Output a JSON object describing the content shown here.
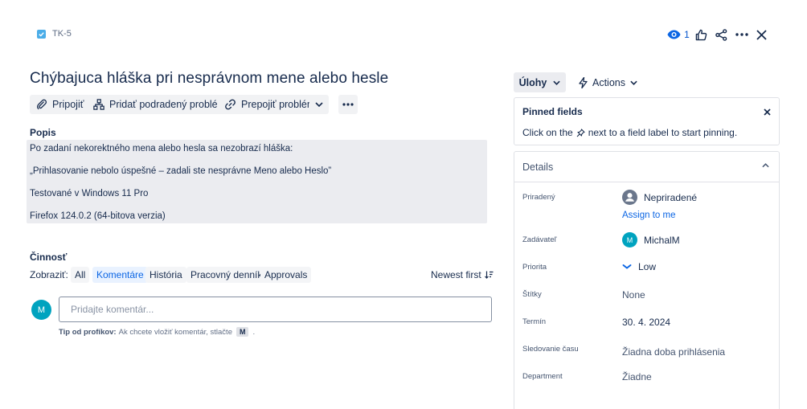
{
  "issue": {
    "key": "TK-5",
    "title": "Chýbajuca hláška pri nesprávnom mene alebo hesle"
  },
  "header": {
    "watchers": "1",
    "watch_icon": "eye-icon",
    "like_icon": "thumbs-up-icon",
    "share_icon": "share-icon",
    "more_icon": "more-icon",
    "close_icon": "close-icon"
  },
  "toolbar": {
    "attach": "Pripojiť",
    "add_child": "Pridať podradený problém",
    "link": "Prepojiť problém"
  },
  "description": {
    "label": "Popis",
    "lines": [
      "Po zadaní nekorektného mena alebo hesla sa nezobrazí hláška:",
      "„Prihlasovanie nebolo úspešné – zadali ste nesprávne Meno alebo Heslo”",
      "Testované v Windows 11 Pro",
      "Firefox 124.0.2 (64-bitova verzia)"
    ]
  },
  "activity": {
    "label": "Činnosť",
    "show_label": "Zobraziť:",
    "filters": [
      "All",
      "Komentáre",
      "História",
      "Pracovný denník",
      "Approvals"
    ],
    "active_filter": "Komentáre",
    "sort": "Newest first",
    "comment_placeholder": "Pridajte komentár...",
    "avatar_initial": "M",
    "tip_bold": "Tip od profíkov:",
    "tip_text": "Ak chcete vložiť komentár, stlačte",
    "tip_key": "M",
    "tip_end": "."
  },
  "sidebar": {
    "status": "Úlohy",
    "actions": "Actions",
    "pinned": {
      "title": "Pinned fields",
      "text_before": "Click on the",
      "text_after": "next to a field label to start pinning."
    },
    "details": {
      "title": "Details",
      "fields": [
        {
          "label": "Priradený",
          "value": "Nepriradené"
        },
        {
          "label": "Zadávateľ",
          "value": "MichalM"
        },
        {
          "label": "Priorita",
          "value": "Low"
        },
        {
          "label": "Štítky",
          "value": "None"
        },
        {
          "label": "Termín",
          "value": "30. 4. 2024"
        },
        {
          "label": "Sledovanie času",
          "value": "Žiadna doba prihlásenia"
        },
        {
          "label": "Department",
          "value": "Žiadne"
        }
      ],
      "assign_me": "Assign to me",
      "reporter_initial": "M"
    }
  },
  "colors": {
    "accent": "#0c66e4",
    "avatar": "#00a3bf",
    "task_icon": "#4bade8"
  }
}
